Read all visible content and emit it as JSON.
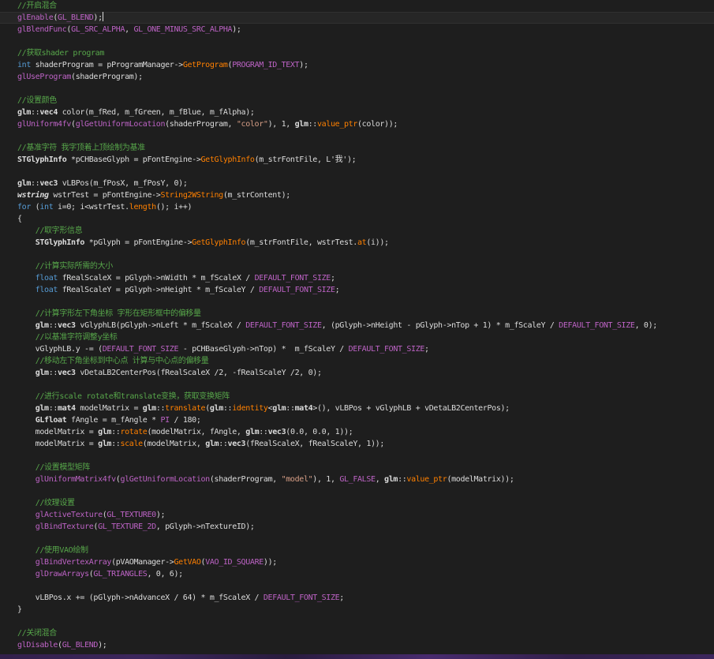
{
  "editor": {
    "colors": {
      "background": "#1e1e1e",
      "comment": "#57a64a",
      "keyword": "#569cd6",
      "macro": "#bd63c5",
      "function": "#ff8000",
      "string": "#d69d85",
      "default": "#dcdcdc"
    },
    "lines": [
      [
        {
          "t": "comment",
          "v": "//开启混合"
        }
      ],
      [
        {
          "t": "api",
          "v": "glEnable"
        },
        {
          "t": "default",
          "v": "("
        },
        {
          "t": "macro",
          "v": "GL_BLEND"
        },
        {
          "t": "default",
          "v": ");"
        },
        {
          "t": "caret",
          "v": ""
        }
      ],
      [
        {
          "t": "api",
          "v": "glBlendFunc"
        },
        {
          "t": "default",
          "v": "("
        },
        {
          "t": "macro",
          "v": "GL_SRC_ALPHA"
        },
        {
          "t": "default",
          "v": ", "
        },
        {
          "t": "macro",
          "v": "GL_ONE_MINUS_SRC_ALPHA"
        },
        {
          "t": "default",
          "v": ");"
        }
      ],
      [],
      [
        {
          "t": "comment",
          "v": "//获取shader program"
        }
      ],
      [
        {
          "t": "keyword",
          "v": "int"
        },
        {
          "t": "default",
          "v": " shaderProgram = pProgramManager->"
        },
        {
          "t": "func",
          "v": "GetProgram"
        },
        {
          "t": "default",
          "v": "("
        },
        {
          "t": "macro",
          "v": "PROGRAM_ID_TEXT"
        },
        {
          "t": "default",
          "v": ");"
        }
      ],
      [
        {
          "t": "api",
          "v": "glUseProgram"
        },
        {
          "t": "default",
          "v": "(shaderProgram);"
        }
      ],
      [],
      [
        {
          "t": "comment",
          "v": "//设置颜色"
        }
      ],
      [
        {
          "t": "ns",
          "v": "glm"
        },
        {
          "t": "default",
          "v": "::"
        },
        {
          "t": "bold",
          "v": "vec4"
        },
        {
          "t": "default",
          "v": " color(m_fRed, m_fGreen, m_fBlue, m_fAlpha);"
        }
      ],
      [
        {
          "t": "api",
          "v": "glUniform4fv"
        },
        {
          "t": "default",
          "v": "("
        },
        {
          "t": "api",
          "v": "glGetUniformLocation"
        },
        {
          "t": "default",
          "v": "(shaderProgram, "
        },
        {
          "t": "string",
          "v": "\"color\""
        },
        {
          "t": "default",
          "v": "), 1, "
        },
        {
          "t": "ns",
          "v": "glm"
        },
        {
          "t": "default",
          "v": "::"
        },
        {
          "t": "func",
          "v": "value_ptr"
        },
        {
          "t": "default",
          "v": "(color));"
        }
      ],
      [],
      [
        {
          "t": "comment",
          "v": "//基准字符 我字顶着上顶绘制为基准"
        }
      ],
      [
        {
          "t": "bold",
          "v": "STGlyphInfo"
        },
        {
          "t": "default",
          "v": " *pCHBaseGlyph = pFontEngine->"
        },
        {
          "t": "func",
          "v": "GetGlyphInfo"
        },
        {
          "t": "default",
          "v": "(m_strFontFile, L'我');"
        }
      ],
      [],
      [
        {
          "t": "ns",
          "v": "glm"
        },
        {
          "t": "default",
          "v": "::"
        },
        {
          "t": "bold",
          "v": "vec3"
        },
        {
          "t": "default",
          "v": " vLBPos(m_fPosX, m_fPosY, 0);"
        }
      ],
      [
        {
          "t": "italic",
          "v": "wstring"
        },
        {
          "t": "default",
          "v": " wstrTest = pFontEngine->"
        },
        {
          "t": "func",
          "v": "String2WString"
        },
        {
          "t": "default",
          "v": "(m_strContent);"
        }
      ],
      [
        {
          "t": "keyword",
          "v": "for"
        },
        {
          "t": "default",
          "v": " ("
        },
        {
          "t": "keyword",
          "v": "int"
        },
        {
          "t": "default",
          "v": " i=0; i<wstrTest."
        },
        {
          "t": "func",
          "v": "length"
        },
        {
          "t": "default",
          "v": "(); i++)"
        }
      ],
      [
        {
          "t": "default",
          "v": "{"
        }
      ],
      [
        {
          "t": "default",
          "v": "    "
        },
        {
          "t": "comment",
          "v": "//取字形信息"
        }
      ],
      [
        {
          "t": "default",
          "v": "    "
        },
        {
          "t": "bold",
          "v": "STGlyphInfo"
        },
        {
          "t": "default",
          "v": " *pGlyph = pFontEngine->"
        },
        {
          "t": "func",
          "v": "GetGlyphInfo"
        },
        {
          "t": "default",
          "v": "(m_strFontFile, wstrTest."
        },
        {
          "t": "func",
          "v": "at"
        },
        {
          "t": "default",
          "v": "(i));"
        }
      ],
      [],
      [
        {
          "t": "default",
          "v": "    "
        },
        {
          "t": "comment",
          "v": "//计算实际所需的大小"
        }
      ],
      [
        {
          "t": "default",
          "v": "    "
        },
        {
          "t": "keyword",
          "v": "float"
        },
        {
          "t": "default",
          "v": " fRealScaleX = pGlyph->nWidth * m_fScaleX / "
        },
        {
          "t": "macro",
          "v": "DEFAULT_FONT_SIZE"
        },
        {
          "t": "default",
          "v": ";"
        }
      ],
      [
        {
          "t": "default",
          "v": "    "
        },
        {
          "t": "keyword",
          "v": "float"
        },
        {
          "t": "default",
          "v": " fRealScaleY = pGlyph->nHeight * m_fScaleY / "
        },
        {
          "t": "macro",
          "v": "DEFAULT_FONT_SIZE"
        },
        {
          "t": "default",
          "v": ";"
        }
      ],
      [],
      [
        {
          "t": "default",
          "v": "    "
        },
        {
          "t": "comment",
          "v": "//计算字形左下角坐标 字形在矩形框中的偏移量"
        }
      ],
      [
        {
          "t": "default",
          "v": "    "
        },
        {
          "t": "ns",
          "v": "glm"
        },
        {
          "t": "default",
          "v": "::"
        },
        {
          "t": "bold",
          "v": "vec3"
        },
        {
          "t": "default",
          "v": " vGlyphLB(pGlyph->nLeft * m_fScaleX / "
        },
        {
          "t": "macro",
          "v": "DEFAULT_FONT_SIZE"
        },
        {
          "t": "default",
          "v": ", (pGlyph->nHeight - pGlyph->nTop + 1) * m_fScaleY / "
        },
        {
          "t": "macro",
          "v": "DEFAULT_FONT_SIZE"
        },
        {
          "t": "default",
          "v": ", 0);"
        }
      ],
      [
        {
          "t": "default",
          "v": "    "
        },
        {
          "t": "comment",
          "v": "//以基准字符调整y坐标"
        }
      ],
      [
        {
          "t": "default",
          "v": "    vGlyphLB.y -= ("
        },
        {
          "t": "macro",
          "v": "DEFAULT_FONT_SIZE"
        },
        {
          "t": "default",
          "v": " - pCHBaseGlyph->nTop) *  m_fScaleY / "
        },
        {
          "t": "macro",
          "v": "DEFAULT_FONT_SIZE"
        },
        {
          "t": "default",
          "v": ";"
        }
      ],
      [
        {
          "t": "default",
          "v": "    "
        },
        {
          "t": "comment",
          "v": "//移动左下角坐标到中心点 计算与中心点的偏移量"
        }
      ],
      [
        {
          "t": "default",
          "v": "    "
        },
        {
          "t": "ns",
          "v": "glm"
        },
        {
          "t": "default",
          "v": "::"
        },
        {
          "t": "bold",
          "v": "vec3"
        },
        {
          "t": "default",
          "v": " vDetaLB2CenterPos(fRealScaleX /2, -fRealScaleY /2, 0);"
        }
      ],
      [],
      [
        {
          "t": "default",
          "v": "    "
        },
        {
          "t": "comment",
          "v": "//进行scale rotate和translate变换，获取变换矩阵"
        }
      ],
      [
        {
          "t": "default",
          "v": "    "
        },
        {
          "t": "ns",
          "v": "glm"
        },
        {
          "t": "default",
          "v": "::"
        },
        {
          "t": "bold",
          "v": "mat4"
        },
        {
          "t": "default",
          "v": " modelMatrix = "
        },
        {
          "t": "ns",
          "v": "glm"
        },
        {
          "t": "default",
          "v": "::"
        },
        {
          "t": "func",
          "v": "translate"
        },
        {
          "t": "default",
          "v": "("
        },
        {
          "t": "ns",
          "v": "glm"
        },
        {
          "t": "default",
          "v": "::"
        },
        {
          "t": "func",
          "v": "identity"
        },
        {
          "t": "default",
          "v": "<"
        },
        {
          "t": "ns",
          "v": "glm"
        },
        {
          "t": "default",
          "v": "::"
        },
        {
          "t": "bold",
          "v": "mat4"
        },
        {
          "t": "default",
          "v": ">(), vLBPos + vGlyphLB + vDetaLB2CenterPos);"
        }
      ],
      [
        {
          "t": "default",
          "v": "    "
        },
        {
          "t": "bold",
          "v": "GLfloat"
        },
        {
          "t": "default",
          "v": " fAngle = m_fAngle * "
        },
        {
          "t": "macro",
          "v": "PI"
        },
        {
          "t": "default",
          "v": " / 180;"
        }
      ],
      [
        {
          "t": "default",
          "v": "    modelMatrix = "
        },
        {
          "t": "ns",
          "v": "glm"
        },
        {
          "t": "default",
          "v": "::"
        },
        {
          "t": "func",
          "v": "rotate"
        },
        {
          "t": "default",
          "v": "(modelMatrix, fAngle, "
        },
        {
          "t": "ns",
          "v": "glm"
        },
        {
          "t": "default",
          "v": "::"
        },
        {
          "t": "bold",
          "v": "vec3"
        },
        {
          "t": "default",
          "v": "(0.0, 0.0, 1));"
        }
      ],
      [
        {
          "t": "default",
          "v": "    modelMatrix = "
        },
        {
          "t": "ns",
          "v": "glm"
        },
        {
          "t": "default",
          "v": "::"
        },
        {
          "t": "func",
          "v": "scale"
        },
        {
          "t": "default",
          "v": "(modelMatrix, "
        },
        {
          "t": "ns",
          "v": "glm"
        },
        {
          "t": "default",
          "v": "::"
        },
        {
          "t": "bold",
          "v": "vec3"
        },
        {
          "t": "default",
          "v": "(fRealScaleX, fRealScaleY, 1));"
        }
      ],
      [],
      [
        {
          "t": "default",
          "v": "    "
        },
        {
          "t": "comment",
          "v": "//设置模型矩阵"
        }
      ],
      [
        {
          "t": "default",
          "v": "    "
        },
        {
          "t": "api",
          "v": "glUniformMatrix4fv"
        },
        {
          "t": "default",
          "v": "("
        },
        {
          "t": "api",
          "v": "glGetUniformLocation"
        },
        {
          "t": "default",
          "v": "(shaderProgram, "
        },
        {
          "t": "string",
          "v": "\"model\""
        },
        {
          "t": "default",
          "v": "), 1, "
        },
        {
          "t": "macro",
          "v": "GL_FALSE"
        },
        {
          "t": "default",
          "v": ", "
        },
        {
          "t": "ns",
          "v": "glm"
        },
        {
          "t": "default",
          "v": "::"
        },
        {
          "t": "func",
          "v": "value_ptr"
        },
        {
          "t": "default",
          "v": "(modelMatrix));"
        }
      ],
      [],
      [
        {
          "t": "default",
          "v": "    "
        },
        {
          "t": "comment",
          "v": "//纹理设置"
        }
      ],
      [
        {
          "t": "default",
          "v": "    "
        },
        {
          "t": "api",
          "v": "glActiveTexture"
        },
        {
          "t": "default",
          "v": "("
        },
        {
          "t": "macro",
          "v": "GL_TEXTURE0"
        },
        {
          "t": "default",
          "v": ");"
        }
      ],
      [
        {
          "t": "default",
          "v": "    "
        },
        {
          "t": "api",
          "v": "glBindTexture"
        },
        {
          "t": "default",
          "v": "("
        },
        {
          "t": "macro",
          "v": "GL_TEXTURE_2D"
        },
        {
          "t": "default",
          "v": ", pGlyph->nTextureID);"
        }
      ],
      [],
      [
        {
          "t": "default",
          "v": "    "
        },
        {
          "t": "comment",
          "v": "//使用VAO绘制"
        }
      ],
      [
        {
          "t": "default",
          "v": "    "
        },
        {
          "t": "api",
          "v": "glBindVertexArray"
        },
        {
          "t": "default",
          "v": "(pVAOManager->"
        },
        {
          "t": "func",
          "v": "GetVAO"
        },
        {
          "t": "default",
          "v": "("
        },
        {
          "t": "macro",
          "v": "VAO_ID_SQUARE"
        },
        {
          "t": "default",
          "v": "));"
        }
      ],
      [
        {
          "t": "default",
          "v": "    "
        },
        {
          "t": "api",
          "v": "glDrawArrays"
        },
        {
          "t": "default",
          "v": "("
        },
        {
          "t": "macro",
          "v": "GL_TRIANGLES"
        },
        {
          "t": "default",
          "v": ", 0, 6);"
        }
      ],
      [],
      [
        {
          "t": "default",
          "v": "    vLBPos.x += (pGlyph->nAdvanceX / 64) * m_fScaleX / "
        },
        {
          "t": "macro",
          "v": "DEFAULT_FONT_SIZE"
        },
        {
          "t": "default",
          "v": ";"
        }
      ],
      [
        {
          "t": "default",
          "v": "}"
        }
      ],
      [],
      [
        {
          "t": "comment",
          "v": "//关闭混合"
        }
      ],
      [
        {
          "t": "api",
          "v": "glDisable"
        },
        {
          "t": "default",
          "v": "("
        },
        {
          "t": "macro",
          "v": "GL_BLEND"
        },
        {
          "t": "default",
          "v": ");"
        }
      ]
    ]
  }
}
